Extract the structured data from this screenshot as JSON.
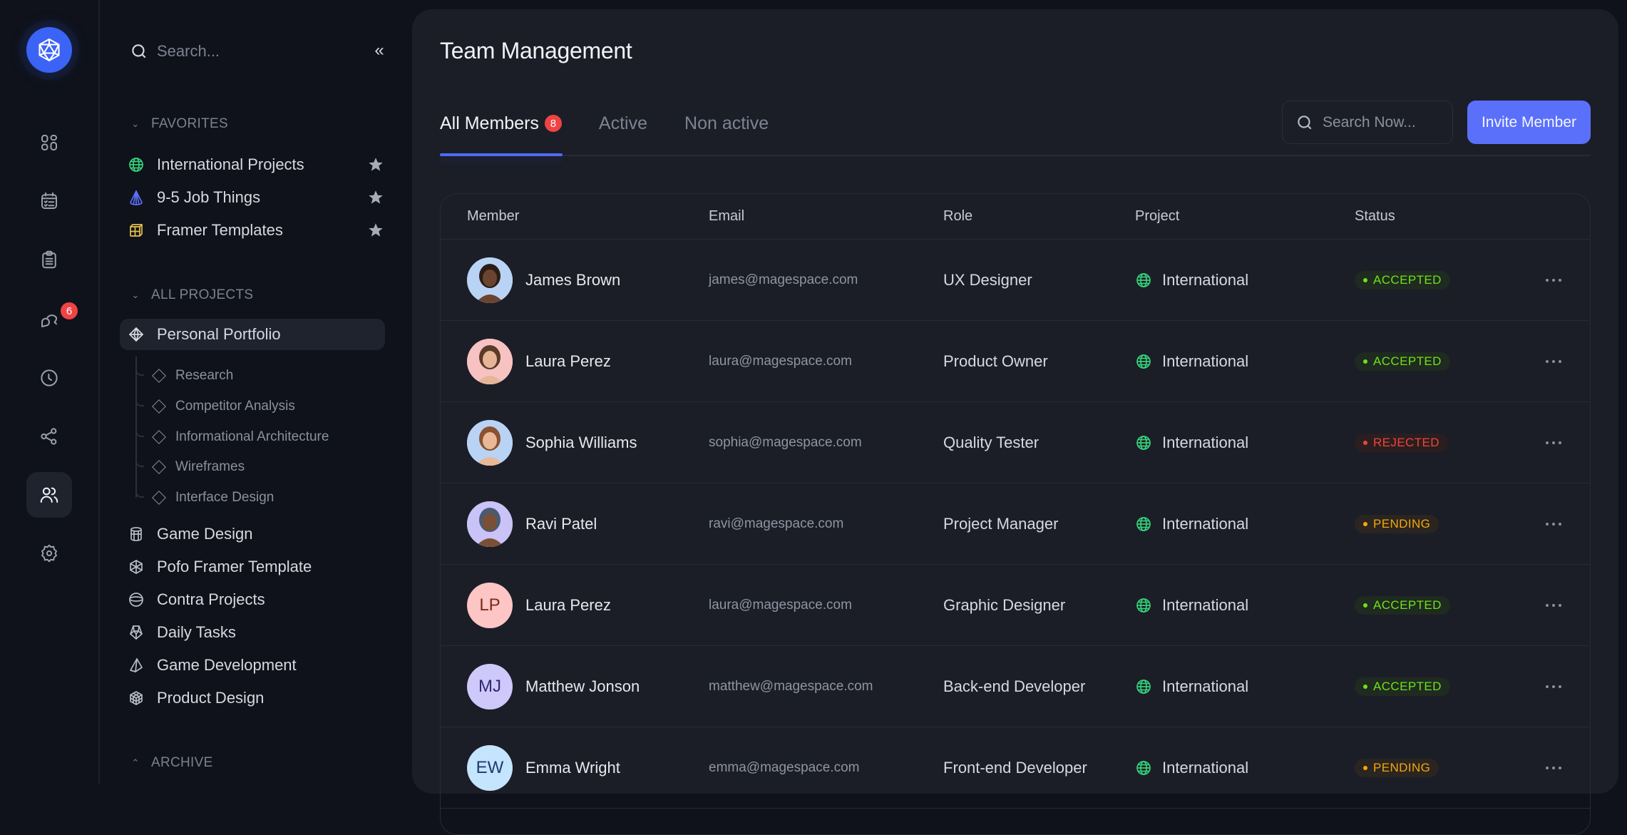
{
  "rail": {
    "logo": "icosahedron-logo",
    "items": [
      {
        "icon": "dashboard-grid-icon",
        "active": false
      },
      {
        "icon": "calendar-checklist-icon",
        "active": false
      },
      {
        "icon": "clipboard-icon",
        "active": false
      },
      {
        "icon": "chat-bubbles-icon",
        "active": false,
        "badge": "6"
      },
      {
        "icon": "clock-icon",
        "active": false
      },
      {
        "icon": "share-icon",
        "active": false
      },
      {
        "icon": "users-icon",
        "active": true
      },
      {
        "icon": "gear-icon",
        "active": false
      }
    ]
  },
  "sidebar": {
    "search_placeholder": "Search...",
    "collapse_label": "«",
    "favorites": {
      "heading": "FAVORITES",
      "items": [
        {
          "label": "International Projects",
          "icon": "globe-icon",
          "color": "#34d37a"
        },
        {
          "label": "9-5 Job Things",
          "icon": "cone-icon",
          "color": "#5b70fa"
        },
        {
          "label": "Framer Templates",
          "icon": "cube-icon",
          "color": "#e8c14a"
        }
      ]
    },
    "projects": {
      "heading": "ALL PROJECTS",
      "active": {
        "label": "Personal Portfolio",
        "icon": "octahedron-icon"
      },
      "subitems": [
        "Research",
        "Competitor Analysis",
        "Informational Architecture",
        "Wireframes",
        "Interface Design"
      ],
      "items": [
        {
          "label": "Game Design",
          "icon": "cylinder-icon"
        },
        {
          "label": "Pofo Framer Template",
          "icon": "polyhedron-icon"
        },
        {
          "label": "Contra Projects",
          "icon": "sphere-icon"
        },
        {
          "label": "Daily Tasks",
          "icon": "prism-icon"
        },
        {
          "label": "Game Development",
          "icon": "pyramid-icon"
        },
        {
          "label": "Product Design",
          "icon": "grid-cube-icon"
        }
      ]
    },
    "archive": {
      "heading": "ARCHIVE"
    }
  },
  "main": {
    "title": "Team Management",
    "tabs": [
      {
        "label": "All Members",
        "badge": "8",
        "active": true
      },
      {
        "label": "Active",
        "active": false
      },
      {
        "label": "Non active",
        "active": false
      }
    ],
    "search_placeholder": "Search Now...",
    "invite_label": "Invite Member",
    "accent": "#5b70fa",
    "table": {
      "headers": [
        "Member",
        "Email",
        "Role",
        "Project",
        "Status"
      ],
      "rows": [
        {
          "name": "James Brown",
          "avatar": "photo",
          "avatar_bg": "#b9d3f5",
          "email": "james@magespace.com",
          "role": "UX Designer",
          "project": "International",
          "status": "ACCEPTED"
        },
        {
          "name": "Laura Perez",
          "avatar": "photo",
          "avatar_bg": "#f7c2c2",
          "email": "laura@magespace.com",
          "role": "Product Owner",
          "project": "International",
          "status": "ACCEPTED"
        },
        {
          "name": "Sophia Williams",
          "avatar": "photo",
          "avatar_bg": "#b9d3f5",
          "email": "sophia@magespace.com",
          "role": "Quality Tester",
          "project": "International",
          "status": "REJECTED"
        },
        {
          "name": "Ravi Patel",
          "avatar": "photo",
          "avatar_bg": "#c9c3f7",
          "email": "ravi@magespace.com",
          "role": "Project Manager",
          "project": "International",
          "status": "PENDING"
        },
        {
          "name": "Laura Perez",
          "avatar": "LP",
          "avatar_bg": "#fec5c5",
          "avatar_fg": "#7a2a1a",
          "email": "laura@magespace.com",
          "role": "Graphic Designer",
          "project": "International",
          "status": "ACCEPTED"
        },
        {
          "name": "Matthew Jonson",
          "avatar": "MJ",
          "avatar_bg": "#cfc8fb",
          "avatar_fg": "#2c2a6e",
          "email": "matthew@magespace.com",
          "role": "Back-end Developer",
          "project": "International",
          "status": "ACCEPTED"
        },
        {
          "name": "Emma Wright",
          "avatar": "EW",
          "avatar_bg": "#c5e4fd",
          "avatar_fg": "#1e3a6e",
          "email": "emma@magespace.com",
          "role": "Front-end Developer",
          "project": "International",
          "status": "PENDING"
        }
      ]
    },
    "status_colors": {
      "ACCEPTED": {
        "fg": "#6ee21a",
        "bg": "#1f2a20"
      },
      "REJECTED": {
        "fg": "#f04438",
        "bg": "#2a1e20"
      },
      "PENDING": {
        "fg": "#f5a70b",
        "bg": "#2a2520"
      }
    }
  }
}
